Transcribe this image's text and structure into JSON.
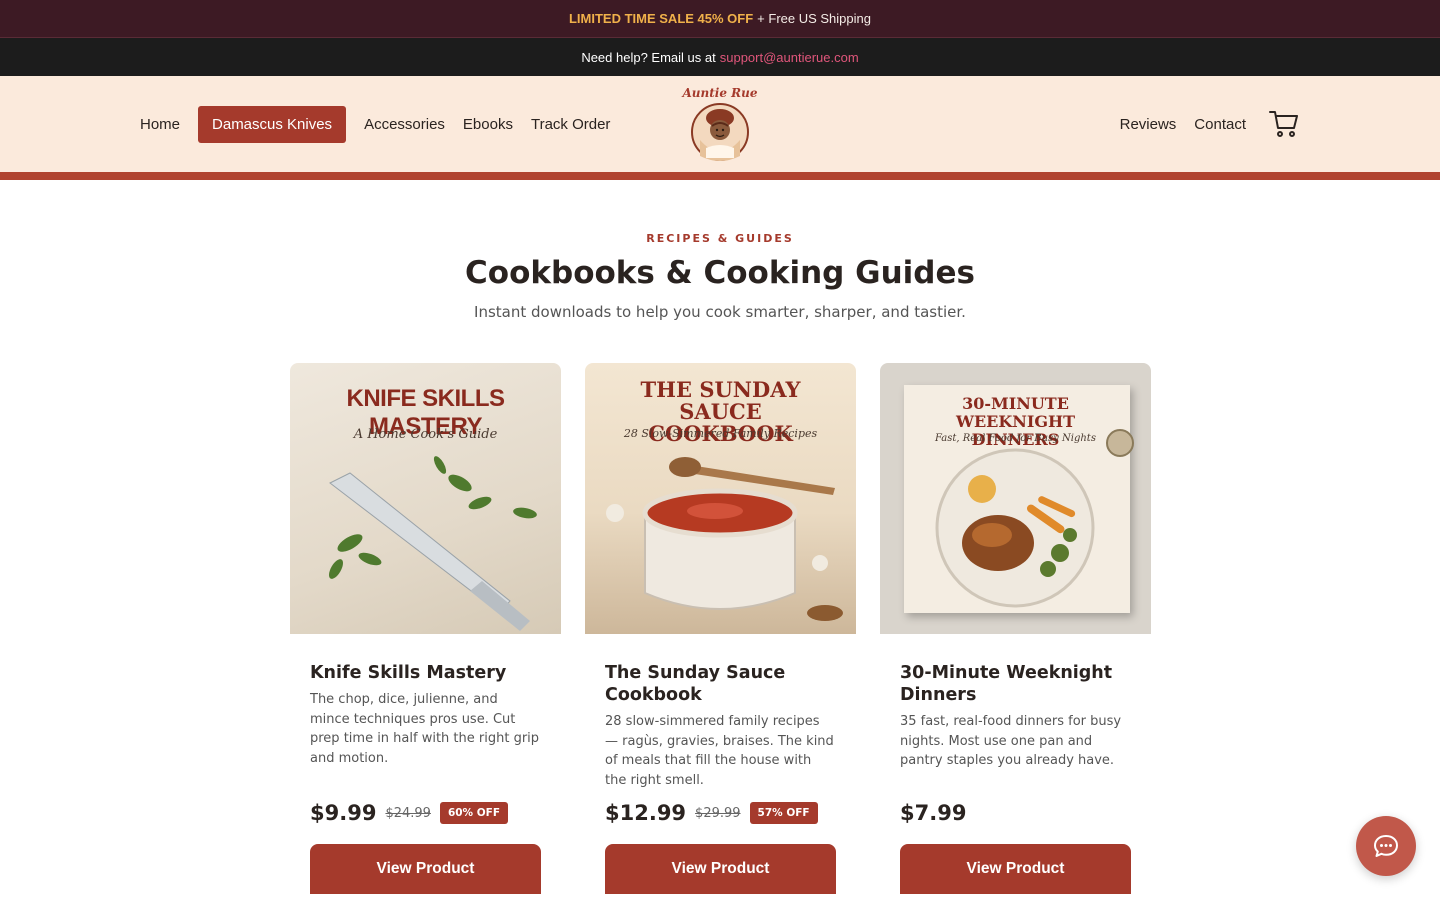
{
  "promo": {
    "sale_text": "LIMITED TIME SALE 45% OFF",
    "rest_text": "+ Free US Shipping"
  },
  "help": {
    "text": "Need help? Email us at",
    "email": "support@auntierue.com"
  },
  "nav": {
    "left_items": [
      {
        "label": "Home",
        "active": false
      },
      {
        "label": "Damascus Knives",
        "active": true
      },
      {
        "label": "Accessories",
        "active": false
      },
      {
        "label": "Ebooks",
        "active": false
      },
      {
        "label": "Track Order",
        "active": false
      }
    ],
    "right_items": [
      {
        "label": "Reviews"
      },
      {
        "label": "Contact"
      }
    ],
    "logo_text": "Auntie Rue",
    "cart_icon": "cart-icon"
  },
  "hero": {
    "eyebrow": "RECIPES & GUIDES",
    "title": "Cookbooks & Cooking Guides",
    "subtitle": "Instant downloads to help you cook smarter, sharper, and tastier."
  },
  "products": [
    {
      "cover_title": "KNIFE SKILLS MASTERY",
      "cover_subtitle": "A Home Cook's Guide",
      "title": "Knife Skills Mastery",
      "description": "The chop, dice, julienne, and mince techniques pros use. Cut prep time in half with the right grip and motion.",
      "price": "$9.99",
      "old_price": "$24.99",
      "badge": "60% OFF",
      "button": "View Product"
    },
    {
      "cover_title": "THE SUNDAY SAUCE COOKBOOK",
      "cover_subtitle": "28 Slow-Simmered Family Recipes",
      "title": "The Sunday Sauce Cookbook",
      "description": "28 slow-simmered family recipes — ragùs, gravies, braises. The kind of meals that fill the house with the right smell.",
      "price": "$12.99",
      "old_price": "$29.99",
      "badge": "57% OFF",
      "button": "View Product"
    },
    {
      "cover_title": "30-MINUTE WEEKNIGHT DINNERS",
      "cover_subtitle": "Fast, Real Food for Busy Nights",
      "title": "30-Minute Weeknight Dinners",
      "description": "35 fast, real-food dinners for busy nights. Most use one pan and pantry staples you already have.",
      "price": "$7.99",
      "old_price": "",
      "badge": "",
      "button": "View Product"
    }
  ],
  "chat": {
    "icon": "chat-icon"
  },
  "colors": {
    "brand": "#a53a2c",
    "promo_bg": "#3d1a24",
    "nav_bg": "#fbeadc",
    "sale_accent": "#f0b14a",
    "email_link": "#e0567b"
  }
}
